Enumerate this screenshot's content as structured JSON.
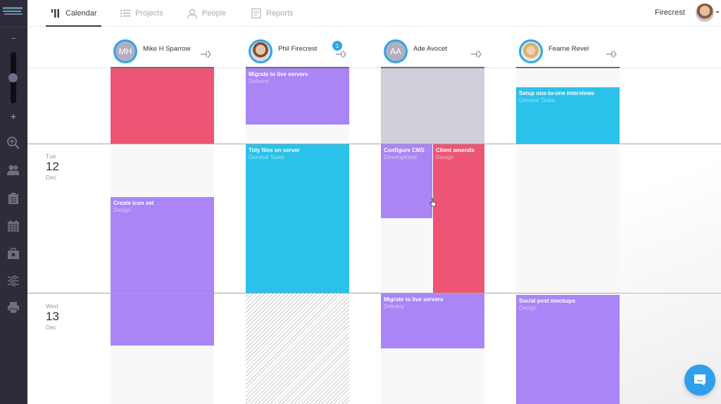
{
  "nav": {
    "tabs": [
      {
        "label": "Calendar",
        "icon": "calendar-bars-icon",
        "active": true
      },
      {
        "label": "Projects",
        "icon": "list-icon",
        "active": false
      },
      {
        "label": "People",
        "icon": "person-icon",
        "active": false
      },
      {
        "label": "Reports",
        "icon": "report-icon",
        "active": false
      }
    ],
    "user_name": "Firecrest"
  },
  "sidebar": {
    "zoom_minus": "−",
    "zoom_plus": "+",
    "zoom_level": 0.4,
    "icons": [
      "zoom-in-icon",
      "people-icon",
      "clipboard-icon",
      "calendar-icon",
      "suitcase-icon",
      "sliders-icon",
      "printer-icon"
    ]
  },
  "people": [
    {
      "name": "Mike H Sparrow",
      "initials": "MH",
      "badge": null
    },
    {
      "name": "Phil Firecrest",
      "initials": "",
      "badge": "1"
    },
    {
      "name": "Ade Avocet",
      "initials": "AA",
      "badge": null
    },
    {
      "name": "Fearne Revel",
      "initials": "",
      "badge": null
    }
  ],
  "dates": [
    {
      "dow": "Tue",
      "day": "12",
      "month": "Dec"
    },
    {
      "dow": "Wed",
      "day": "13",
      "month": "Dec"
    }
  ],
  "tasks": {
    "phil_migrate": {
      "title": "Migrate to live servers",
      "project": "Delivery",
      "color": "#a985f6"
    },
    "fearne_setup": {
      "title": "Setup one-to-one interviews",
      "project": "General Tasks",
      "color": "#2ac1ea"
    },
    "phil_tidy": {
      "title": "Tidy files on server",
      "project": "General Tasks",
      "color": "#2ac1ea"
    },
    "ade_cms": {
      "title": "Configure CMS",
      "project": "Development",
      "color": "#a985f6"
    },
    "ade_client": {
      "title": "Client amends",
      "project": "Design",
      "color": "#ec5573"
    },
    "mike_icon": {
      "title": "Create icon set",
      "project": "Design",
      "color": "#a985f6"
    },
    "ade_migrate": {
      "title": "Migrate to live servers",
      "project": "Delivery",
      "color": "#a985f6"
    },
    "fearne_social": {
      "title": "Social post mockups",
      "project": "Design",
      "color": "#a985f6"
    }
  },
  "chat": {
    "icon": "chat-icon"
  }
}
